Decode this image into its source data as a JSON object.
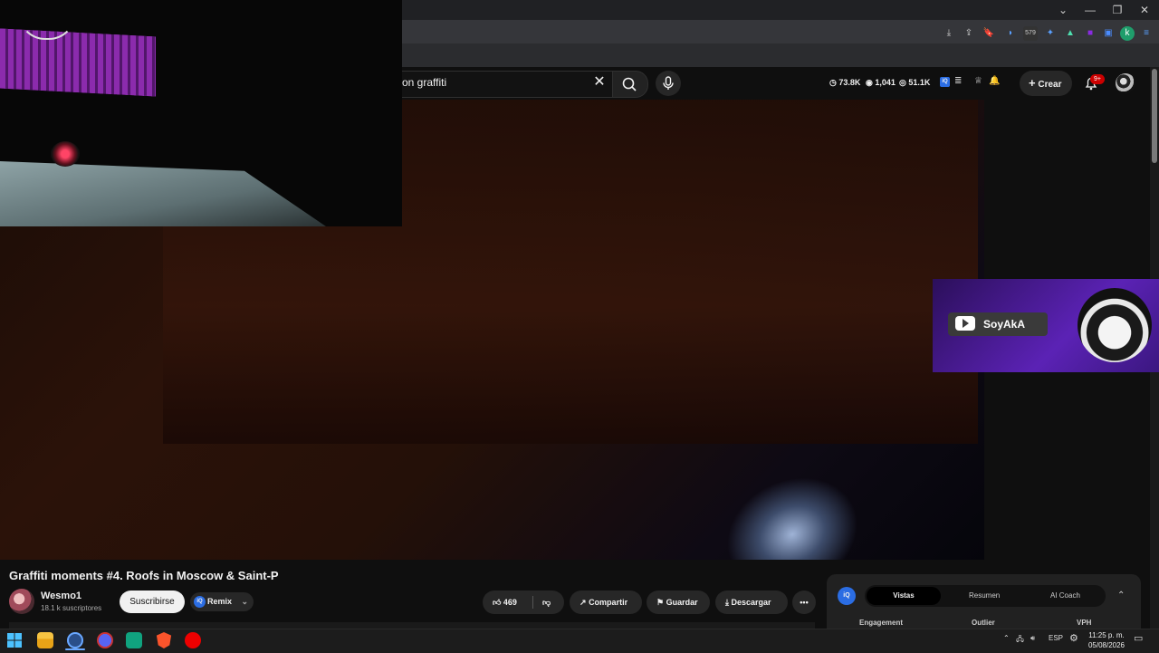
{
  "browser": {
    "window_controls": [
      "⌄",
      "—",
      "❐",
      "✕"
    ],
    "profile_letter": "k",
    "ext_badge": "579"
  },
  "search": {
    "query": "on graffiti"
  },
  "header_stats": {
    "views": "73.8K",
    "viewers": "1,041",
    "total": "51.1K"
  },
  "header": {
    "create_label": "Crear",
    "notif_count": "9+"
  },
  "overlay": {
    "channel_name": "SoyAkA"
  },
  "video": {
    "title": "Graffiti moments #4. Roofs in Moscow & Saint-P",
    "channel": "Wesmo1",
    "subscribers": "18.1 k suscriptores",
    "subscribe_label": "Suscribirse",
    "remix_label": "Remix",
    "likes": "469",
    "share_label": "Compartir",
    "save_label": "Guardar",
    "download_label": "Descargar"
  },
  "panel": {
    "tabs": [
      "Vistas",
      "Resumen",
      "AI Coach"
    ],
    "columns": [
      "Engagement",
      "Outlier",
      "VPH"
    ]
  },
  "taskbar": {
    "language": "ESP",
    "time": "11:25 p. m.",
    "date": "05/08/2026"
  },
  "colors": {
    "accent_red": "#cc0000",
    "badge_purple": "#5b22b5",
    "iq_blue": "#2b6de3"
  }
}
